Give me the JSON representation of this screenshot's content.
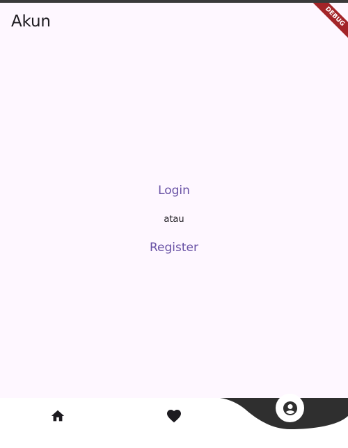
{
  "app_bar": {
    "title": "Akun"
  },
  "debug_banner": {
    "label": "DEBUG",
    "color": "#a32428"
  },
  "auth": {
    "login_label": "Login",
    "separator_text": "atau",
    "register_label": "Register"
  },
  "bottom_nav": {
    "items": [
      {
        "icon": "home-icon",
        "selected": false
      },
      {
        "icon": "heart-icon",
        "selected": false
      },
      {
        "icon": "account-circle-icon",
        "selected": true
      }
    ],
    "active_color": "#2f2f2f"
  },
  "colors": {
    "background": "#fef7ff",
    "link": "#6750a4",
    "text": "#1d1b20"
  }
}
